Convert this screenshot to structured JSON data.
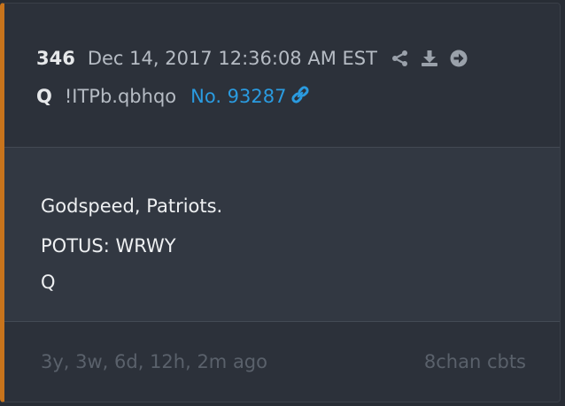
{
  "post": {
    "number": "346",
    "timestamp": "Dec 14, 2017 12:36:08 AM EST",
    "author": "Q",
    "tripcode": "!ITPb.qbhqo",
    "link_text": "No. 93287",
    "body_lines": [
      "Godspeed, Patriots.",
      "POTUS: WRWY",
      "Q"
    ],
    "relative_time": "3y, 3w, 6d, 12h, 2m ago",
    "source": "8chan cbts"
  },
  "icons": {
    "share": "share-icon",
    "download": "download-icon",
    "open": "arrow-circle-right-icon",
    "link": "link-icon"
  },
  "colors": {
    "accent": "#c8741c",
    "link": "#2a9be0",
    "background": "#282d35",
    "body_background": "#323842"
  }
}
